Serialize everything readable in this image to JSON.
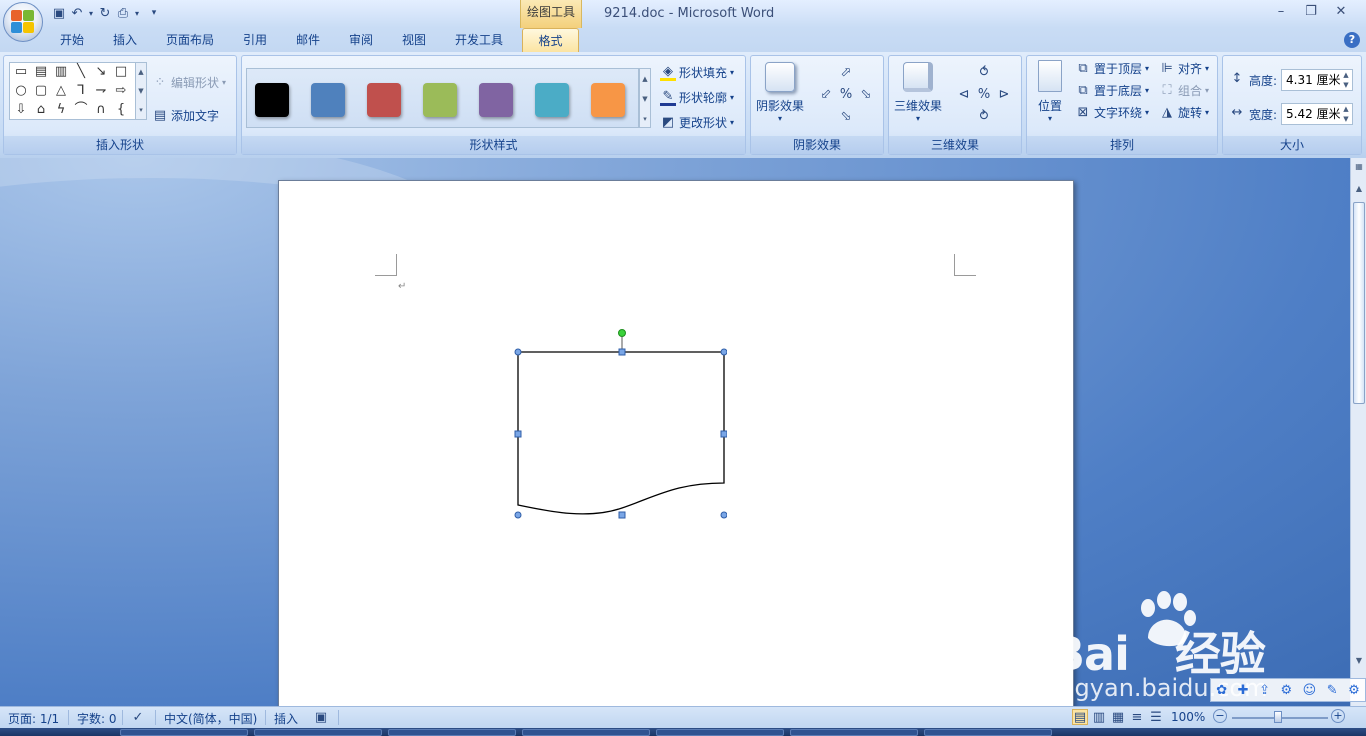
{
  "window": {
    "title": "9214.doc - Microsoft Word",
    "context_tool": "绘图工具",
    "help": "?"
  },
  "tabs": [
    {
      "label": "开始"
    },
    {
      "label": "插入"
    },
    {
      "label": "页面布局"
    },
    {
      "label": "引用"
    },
    {
      "label": "邮件"
    },
    {
      "label": "审阅"
    },
    {
      "label": "视图"
    },
    {
      "label": "开发工具"
    },
    {
      "label": "格式",
      "active": true
    }
  ],
  "ribbon": {
    "insert_shapes": {
      "label": "插入形状",
      "edit_shape": "编辑形状",
      "add_text": "添加文字"
    },
    "shape_styles": {
      "label": "形状样式",
      "fill": "形状填充",
      "outline": "形状轮廓",
      "change": "更改形状",
      "swatches": [
        "#000000",
        "#4f81bd",
        "#c0504d",
        "#9bbb59",
        "#8064a2",
        "#4bacc6",
        "#f79646"
      ]
    },
    "shadow": {
      "label": "阴影效果",
      "button": "阴影效果"
    },
    "threed": {
      "label": "三维效果",
      "button": "三维效果"
    },
    "arrange": {
      "label": "排列",
      "position": "位置",
      "bring_front": "置于顶层",
      "send_back": "置于底层",
      "wrap": "文字环绕",
      "align": "对齐",
      "group": "组合",
      "rotate": "旋转"
    },
    "size": {
      "label": "大小",
      "height_label": "高度:",
      "height_value": "4.31 厘米",
      "width_label": "宽度:",
      "width_value": "5.42 厘米"
    }
  },
  "document": {
    "paragraph_mark": "↵",
    "shape": "flowchart-document"
  },
  "statusbar": {
    "page": "页面: 1/1",
    "words": "字数: 0",
    "language": "中文(简体，中国)",
    "mode": "插入",
    "zoom": "100%"
  },
  "watermark": {
    "text": "Bai",
    "text2": "经验",
    "url": "jingyan.baidu.com"
  }
}
